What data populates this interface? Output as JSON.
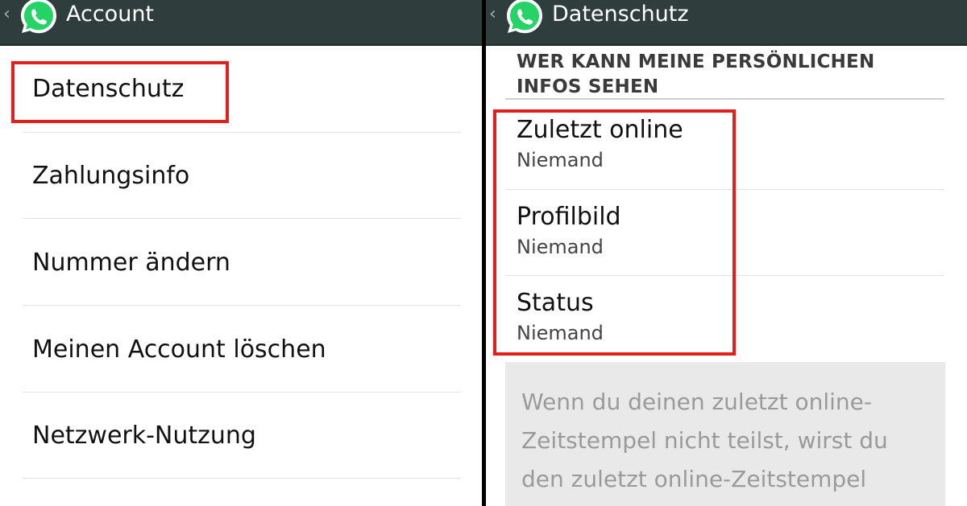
{
  "left": {
    "header": {
      "title": "Account"
    },
    "items": [
      {
        "label": "Datenschutz"
      },
      {
        "label": "Zahlungsinfo"
      },
      {
        "label": "Nummer ändern"
      },
      {
        "label": "Meinen Account löschen"
      },
      {
        "label": "Netzwerk-Nutzung"
      }
    ]
  },
  "right": {
    "header": {
      "title": "Datenschutz"
    },
    "section_title": "WER KANN MEINE PERSÖNLICHEN INFOS SEHEN",
    "settings": [
      {
        "label": "Zuletzt online",
        "value": "Niemand"
      },
      {
        "label": "Profilbild",
        "value": "Niemand"
      },
      {
        "label": "Status",
        "value": "Niemand"
      }
    ],
    "info_text": "Wenn du deinen zuletzt online-Zeitstempel nicht teilst, wirst du den zuletzt online-Zeitstempel"
  },
  "colors": {
    "appbar": "#2f3e3d",
    "highlight": "#e41d1d",
    "whatsapp_green": "#25d366"
  },
  "icons": [
    "back-chevron-icon",
    "whatsapp-logo-icon"
  ]
}
